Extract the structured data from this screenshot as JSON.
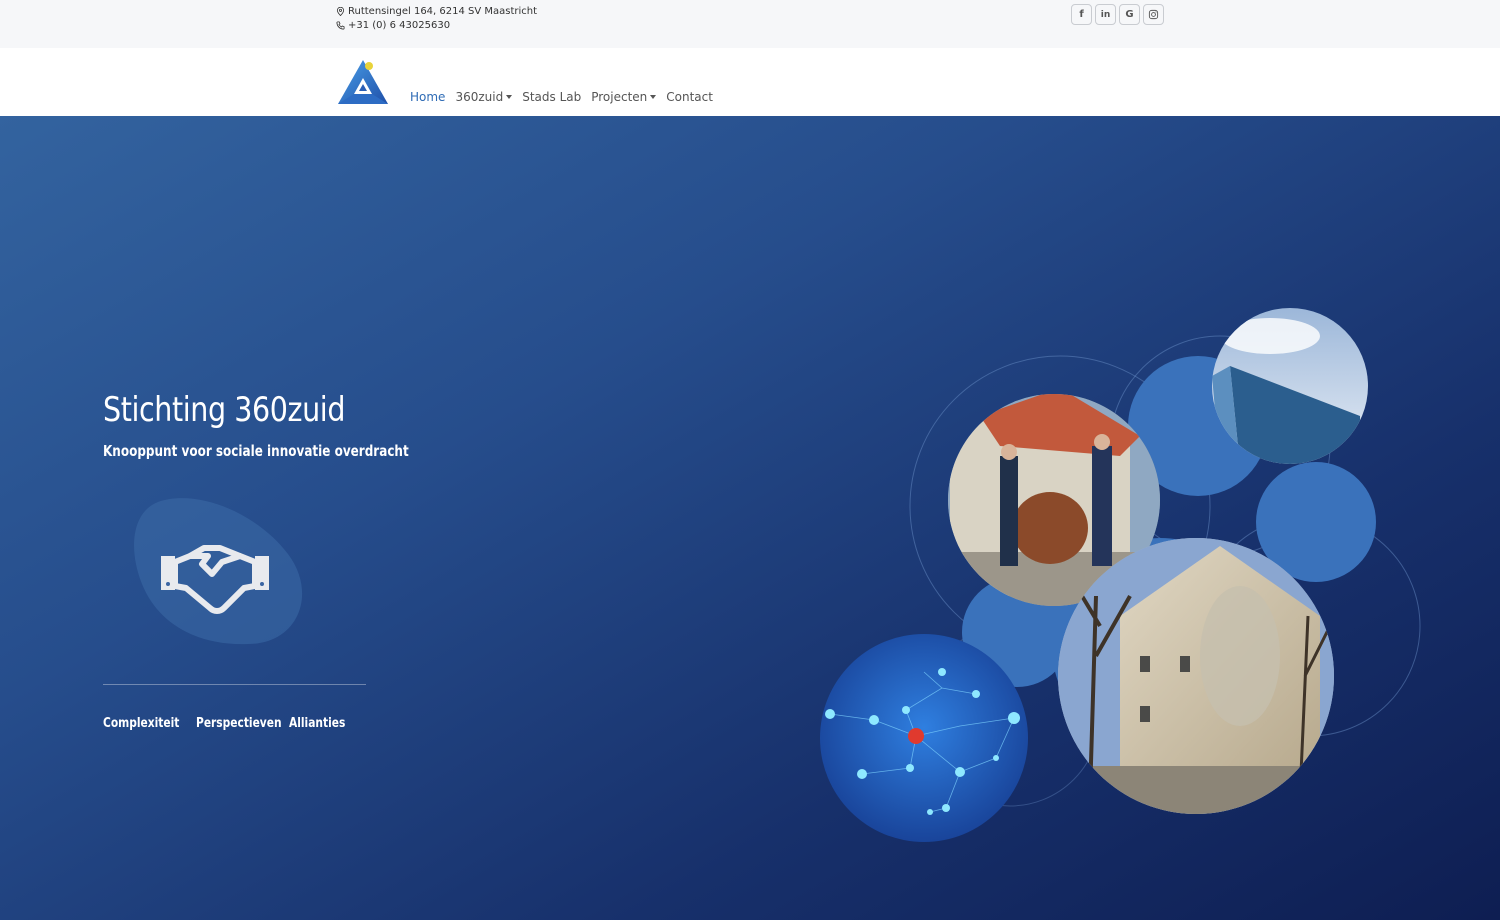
{
  "topbar": {
    "address": "Ruttensingel 164, 6214 SV Maastricht",
    "phone": "+31 (0) 6 43025630",
    "socials": [
      {
        "icon": "facebook-icon",
        "glyph": "f"
      },
      {
        "icon": "linkedin-icon",
        "glyph": "in"
      },
      {
        "icon": "google-icon",
        "glyph": "G"
      },
      {
        "icon": "instagram-icon",
        "glyph": ""
      }
    ]
  },
  "nav": {
    "items": [
      {
        "label": "Home",
        "active": true,
        "dropdown": false
      },
      {
        "label": "360zuid",
        "active": false,
        "dropdown": true
      },
      {
        "label": "Stads Lab",
        "active": false,
        "dropdown": false
      },
      {
        "label": "Projecten",
        "active": false,
        "dropdown": true
      },
      {
        "label": "Contact",
        "active": false,
        "dropdown": false
      }
    ]
  },
  "hero": {
    "title": "Stichting 360zuid",
    "subtitle": "Knooppunt voor sociale innovatie overdracht",
    "icon": "handshake-icon",
    "links": [
      "Complexiteit",
      "Perspectieven",
      "Allianties"
    ]
  },
  "colors": {
    "accent": "#2e6bb5",
    "hero_start": "#33639f",
    "hero_end": "#0e1e52",
    "circle_blue": "#3a72bb"
  }
}
